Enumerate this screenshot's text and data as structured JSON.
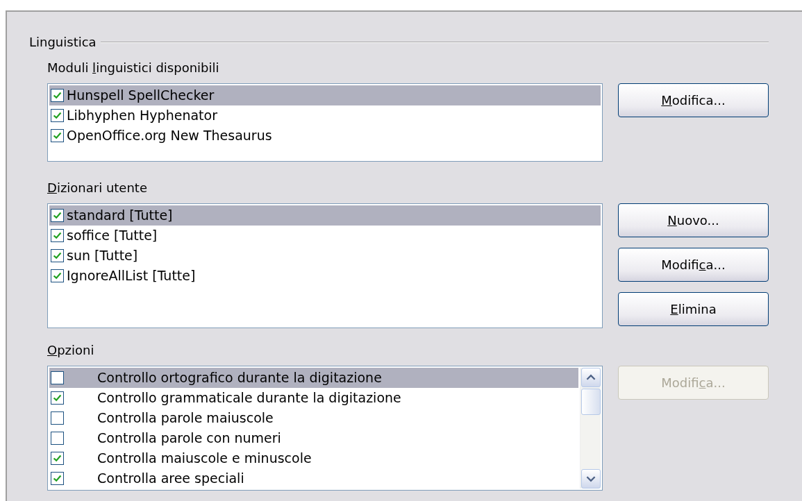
{
  "group": {
    "title": "Linguistica"
  },
  "modules": {
    "label_parts": {
      "before": "Moduli ",
      "key": "l",
      "after": "inguistici disponibili"
    },
    "items": [
      {
        "label": "Hunspell SpellChecker",
        "checked": true,
        "selected": true
      },
      {
        "label": "Libhyphen Hyphenator",
        "checked": true,
        "selected": false
      },
      {
        "label": "OpenOffice.org New Thesaurus",
        "checked": true,
        "selected": false
      }
    ],
    "buttons": [
      {
        "label_parts": {
          "key": "M",
          "after": "odifica..."
        },
        "disabled": false
      }
    ]
  },
  "dictionaries": {
    "label_parts": {
      "key": "D",
      "after": "izionari utente"
    },
    "items": [
      {
        "label": "standard [Tutte]",
        "checked": true,
        "selected": true
      },
      {
        "label": "soffice [Tutte]",
        "checked": true,
        "selected": false
      },
      {
        "label": "sun [Tutte]",
        "checked": true,
        "selected": false
      },
      {
        "label": "IgnoreAllList [Tutte]",
        "checked": true,
        "selected": false
      }
    ],
    "buttons": [
      {
        "label_parts": {
          "key": "N",
          "after": "uovo..."
        },
        "disabled": false
      },
      {
        "label_parts": {
          "before": "Modifi",
          "key": "c",
          "after": "a..."
        },
        "disabled": false
      },
      {
        "label_parts": {
          "key": "E",
          "after": "limina"
        },
        "disabled": false
      }
    ]
  },
  "options": {
    "label_parts": {
      "key": "O",
      "after": "pzioni"
    },
    "items": [
      {
        "label": "Controllo ortografico durante la digitazione",
        "checked": false,
        "selected": true
      },
      {
        "label": "Controllo grammaticale durante la digitazione",
        "checked": true,
        "selected": false
      },
      {
        "label": "Controlla parole maiuscole",
        "checked": false,
        "selected": false
      },
      {
        "label": "Controlla parole con numeri",
        "checked": false,
        "selected": false
      },
      {
        "label": "Controlla maiuscole e minuscole",
        "checked": true,
        "selected": false
      },
      {
        "label": "Controlla aree speciali",
        "checked": true,
        "selected": false
      }
    ],
    "buttons": [
      {
        "label_parts": {
          "before": "Modifi",
          "key": "c",
          "after": "a..."
        },
        "disabled": true
      }
    ]
  }
}
